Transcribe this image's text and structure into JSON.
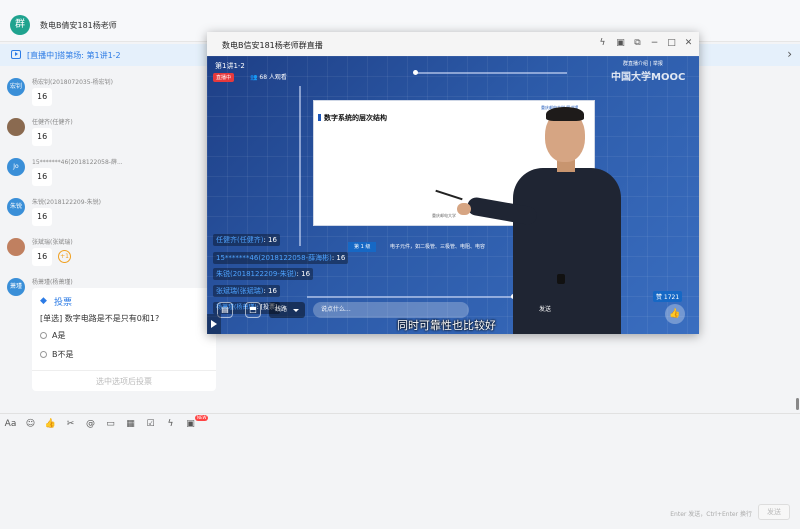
{
  "header": {
    "group_name": "数电B倩安181杨老师",
    "avatar_glyph": "群"
  },
  "live_banner": {
    "text": "[直播中]搭第场: 第1讲1-2"
  },
  "messages": [
    {
      "sender": "杨宏钊(2018072035-杨宏钊)",
      "avatar_text": "宏钊",
      "avatar_color": "#3a8fd8",
      "text": "16"
    },
    {
      "sender": "任健齐(任健齐)",
      "avatar_text": "",
      "avatar_color": "#8a6a50",
      "text": "16"
    },
    {
      "sender": "15*******46(2018122058-薛...",
      "avatar_text": "Jo",
      "avatar_color": "#3a8fd8",
      "text": "16"
    },
    {
      "sender": "朱锐(2018122209-朱锐)",
      "avatar_text": "朱锐",
      "avatar_color": "#3a8fd8",
      "text": "16"
    },
    {
      "sender": "张斌瑞(张斌瑞)",
      "avatar_text": "",
      "avatar_color": "#c08060",
      "text": "16",
      "plus_one": "+1"
    },
    {
      "sender": "杨萧瑾(杨萧瑾)",
      "avatar_text": "萧瑾",
      "avatar_color": "#3a8fd8"
    }
  ],
  "vote": {
    "title": "投票",
    "question": "[单选] 数字电路是不是只有0和1?",
    "options": [
      "A是",
      "B不是"
    ],
    "footer": "选中选项后投票"
  },
  "toolbar": {
    "new_badge": "NEW"
  },
  "input": {
    "hint": "Enter 发送，Ctrl+Enter 换行",
    "send_label": "发送"
  },
  "live_window": {
    "title": "数电B信安181杨老师群直播",
    "lecture": "第1讲1-2",
    "live_badge": "直播中",
    "viewers": "68 人观看",
    "actions": "群直播介绍  |  举报",
    "watermark": "中国大学MOOC",
    "slide_title": "数字系统的层次结构",
    "slide_logo": "重庆邮电大学 图书馆",
    "slide_footer": "重庆邮电大学",
    "level_tag": "第 1 级",
    "level_items": [
      "电子元件，如二极管、三极管、电阻、电容"
    ],
    "danmu": [
      {
        "name": "任健齐(任健齐)",
        "text": ": 16"
      },
      {
        "name": "15*******46(2018122058-薛海彬)",
        "text": ": 16"
      },
      {
        "name": "朱锐(2018122209-朱锐)",
        "text": ": 16"
      },
      {
        "name": "张斌瑞(张斌瑞)",
        "text": ": 16"
      },
      {
        "name": "杨萧瑾(杨萧瑾)",
        "text": ": [投票]"
      }
    ],
    "line_select": "线路",
    "chat_placeholder": "说点什么...",
    "send_label": "发送",
    "subtitle": "同时可靠性也比较好",
    "like_count": "赞 1721"
  }
}
